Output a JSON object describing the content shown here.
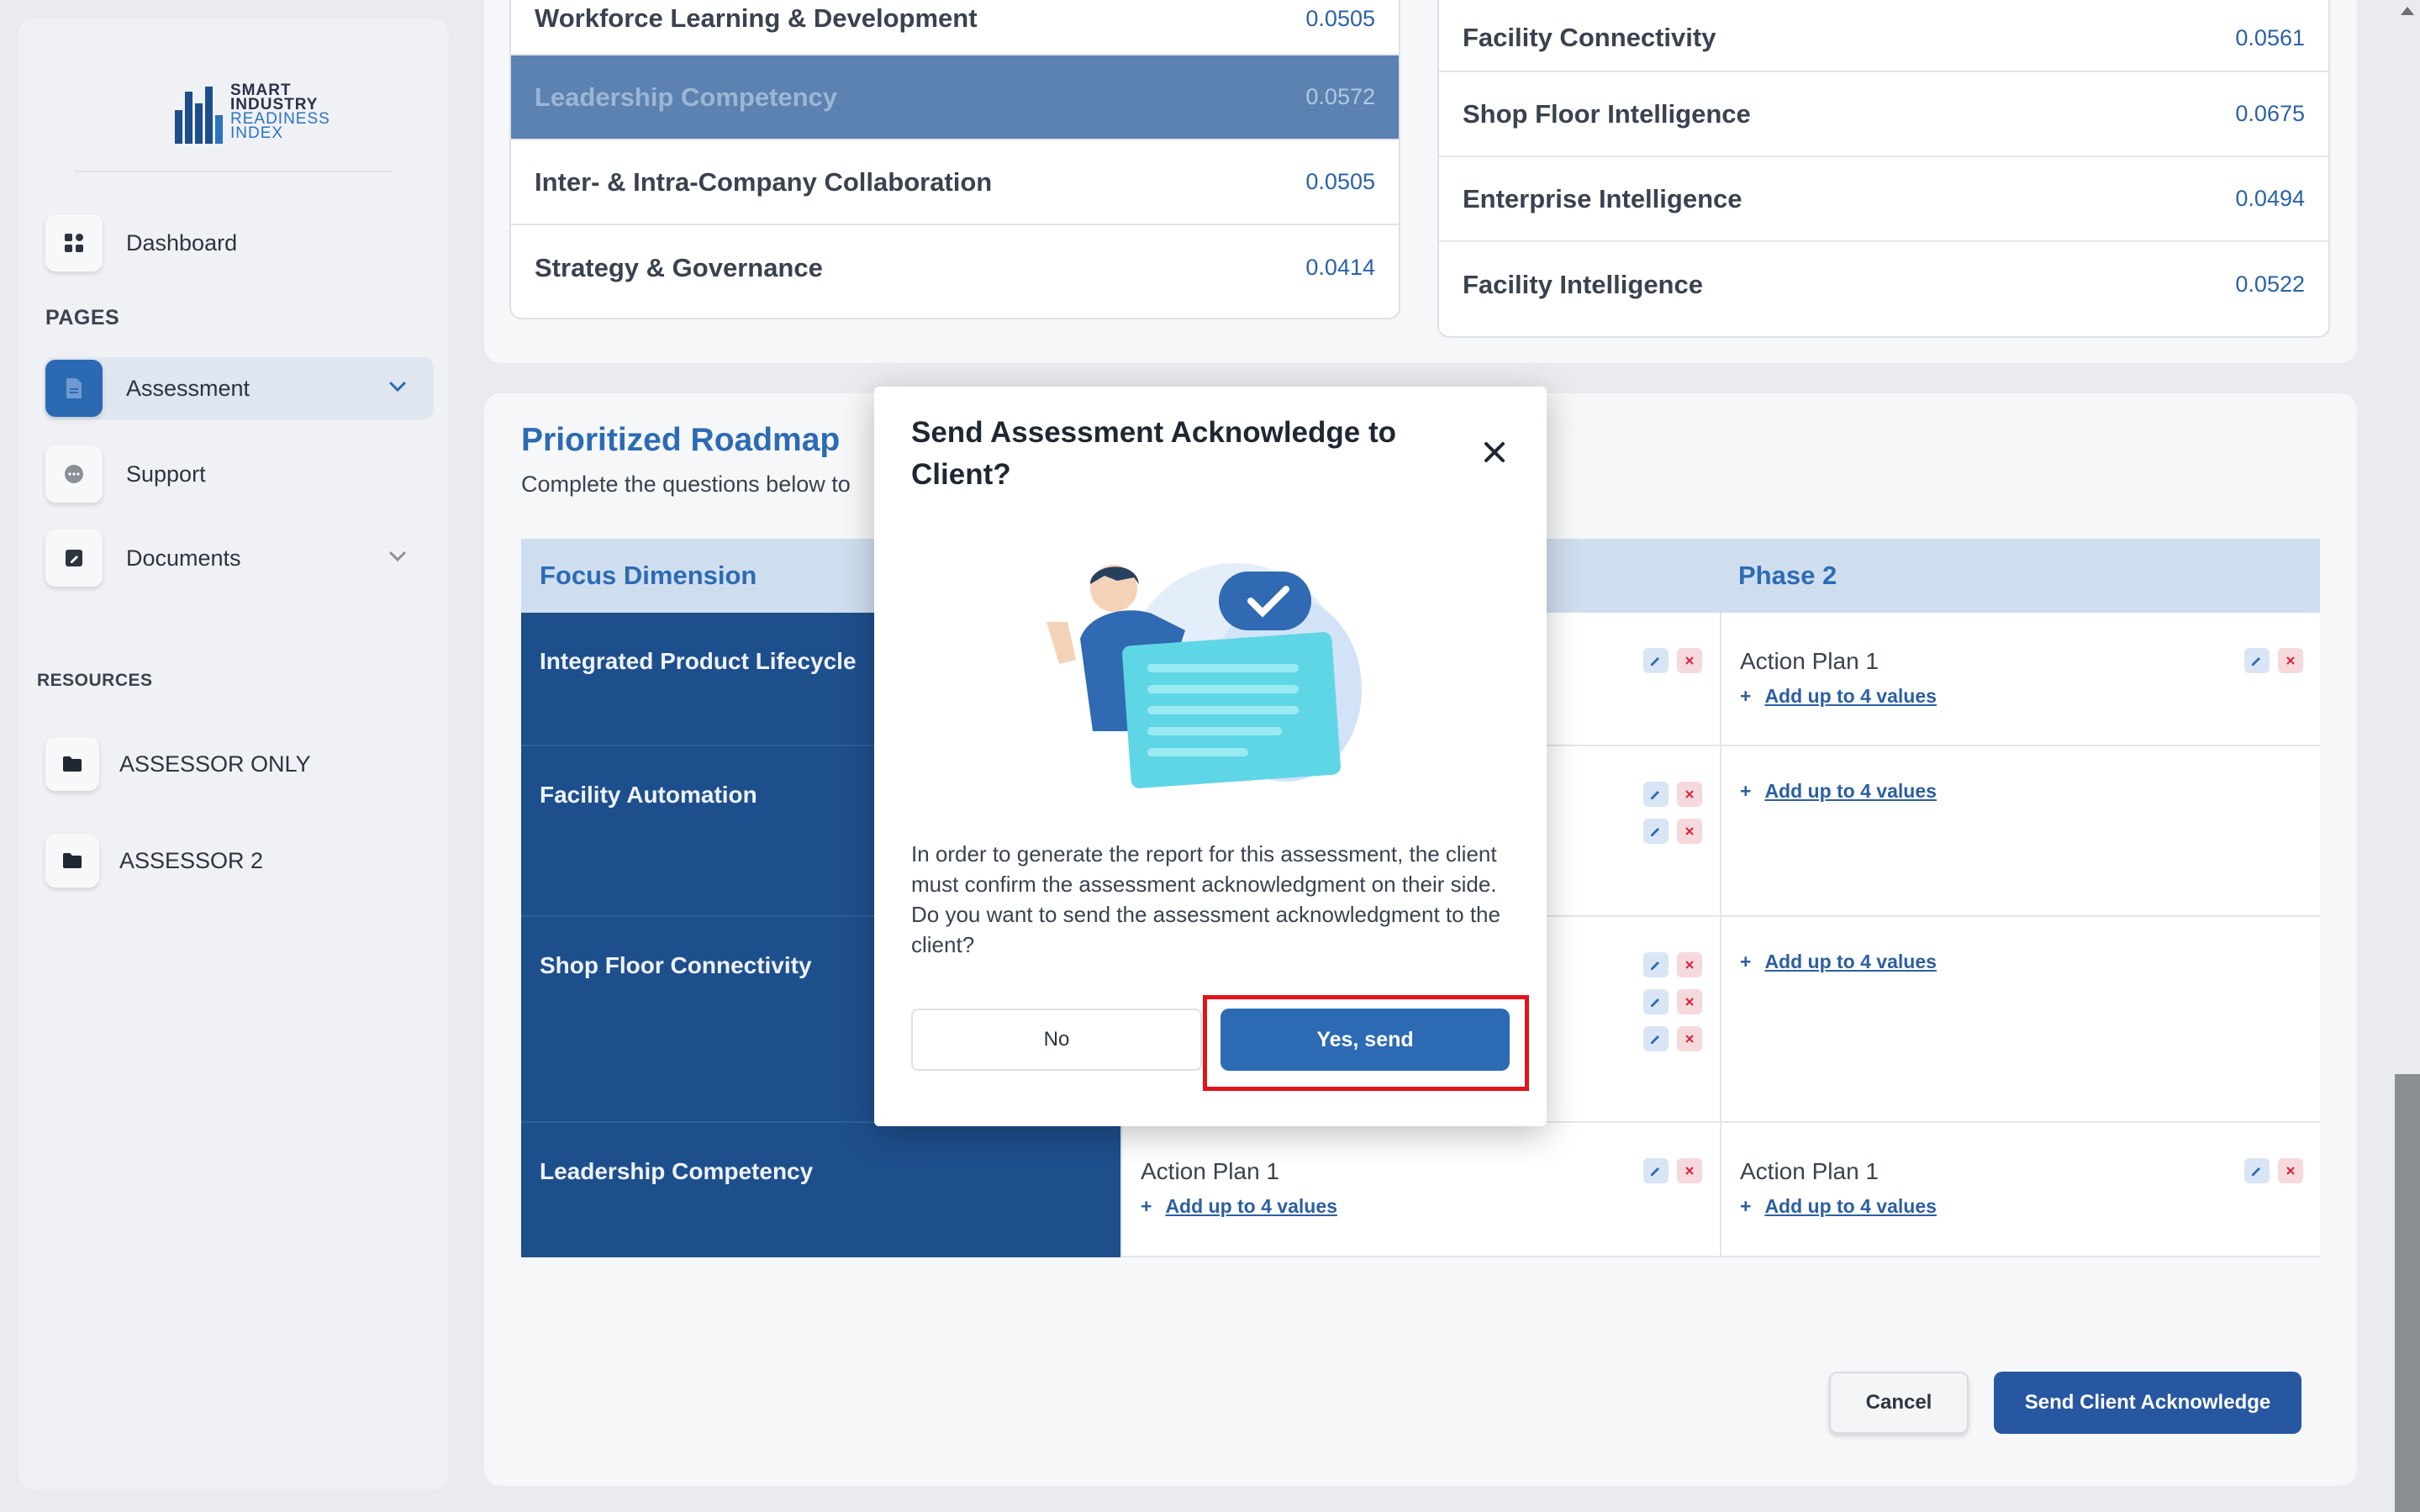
{
  "brand": {
    "logo_lines": [
      "SMART",
      "INDUSTRY",
      "READINESS",
      "INDEX"
    ]
  },
  "sidebar": {
    "dashboard_label": "Dashboard",
    "pages_heading": "PAGES",
    "assessment_label": "Assessment",
    "support_label": "Support",
    "documents_label": "Documents",
    "resources_heading": "RESOURCES",
    "resources": [
      {
        "label": "ASSESSOR ONLY"
      },
      {
        "label": "ASSESSOR 2"
      }
    ]
  },
  "scores_left": [
    {
      "name": "Workforce Learning & Development",
      "value": "0.0505"
    },
    {
      "name": "Leadership Competency",
      "value": "0.0572"
    },
    {
      "name": "Inter- & Intra-Company Collaboration",
      "value": "0.0505"
    },
    {
      "name": "Strategy & Governance",
      "value": "0.0414"
    }
  ],
  "scores_right": [
    {
      "name": "Facility Connectivity",
      "value": "0.0561"
    },
    {
      "name": "Shop Floor Intelligence",
      "value": "0.0675"
    },
    {
      "name": "Enterprise Intelligence",
      "value": "0.0494"
    },
    {
      "name": "Facility Intelligence",
      "value": "0.0522"
    }
  ],
  "roadmap": {
    "title": "Prioritized Roadmap",
    "subtitle": "Complete the questions below to",
    "headers": {
      "focus": "Focus Dimension",
      "phase2": "Phase 2"
    },
    "rows": [
      {
        "focus": "Integrated Product Lifecycle",
        "phase2_action": "Action Plan 1",
        "phase2_add": "Add up to 4 values"
      },
      {
        "focus": "Facility Automation",
        "phase2_add": "Add up to 4 values"
      },
      {
        "focus": "Shop Floor Connectivity",
        "phase2_add": "Add up to 4 values"
      },
      {
        "focus": "Leadership Competency",
        "phase1_action": "Action Plan 1",
        "phase1_add": "Add up to 4 values",
        "phase2_action": "Action Plan 1",
        "phase2_add": "Add up to 4 values"
      }
    ],
    "add_prefix": "+",
    "cancel_label": "Cancel",
    "send_label": "Send Client Acknowledge"
  },
  "modal": {
    "title": "Send Assessment Acknowledge to Client?",
    "close_icon": "close-icon",
    "body": "In order to generate the report for this assessment, the client must confirm the assessment acknowledgment on their side. Do you want to send the assessment acknowledgment to the client?",
    "no_label": "No",
    "yes_label": "Yes, send"
  },
  "colors": {
    "primary": "#2c6bb4",
    "navy": "#1e4f8d",
    "highlight": "#e0141a"
  }
}
